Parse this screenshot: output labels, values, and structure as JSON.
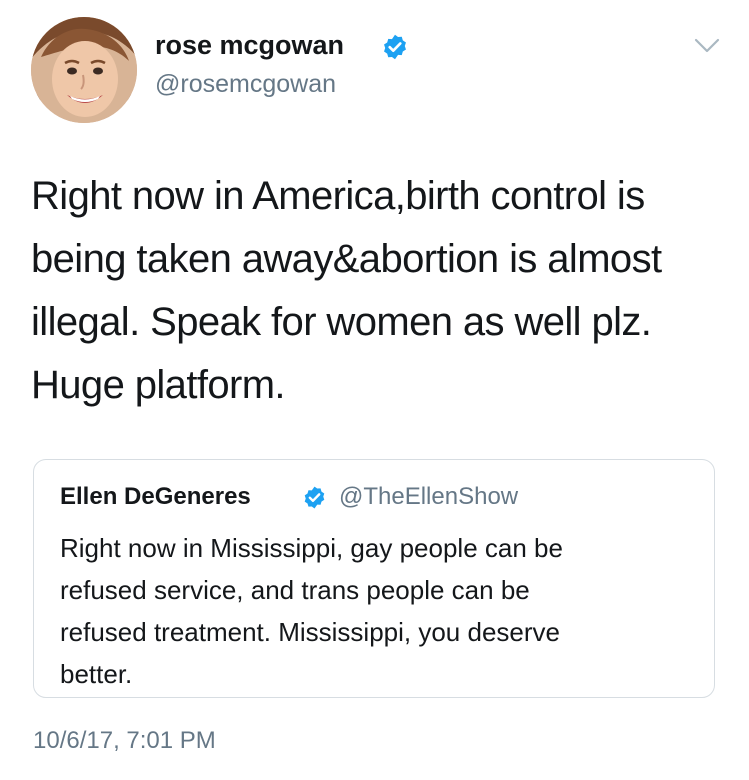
{
  "author": {
    "name": "rose mcgowan",
    "handle": "@rosemcgowan",
    "avatar_icon": "profile-photo",
    "verified_icon": "verified-badge-icon"
  },
  "menu_icon": "chevron-down-icon",
  "tweet": {
    "text": "Right now in America,birth control is\nbeing taken away&abortion is almost\nillegal. Speak for women as well plz.\nHuge platform."
  },
  "quoted_tweet": {
    "name": "Ellen DeGeneres",
    "handle": "@TheEllenShow",
    "text": "Right now in Mississippi, gay people can be\nrefused service, and trans people can be\nrefused treatment. Mississippi, you deserve\nbetter."
  },
  "timestamp": "10/6/17, 7:01 PM",
  "colors": {
    "text": "#14171a",
    "secondary": "#657786",
    "verified": "#1da1f2",
    "border": "#d7dde2"
  }
}
